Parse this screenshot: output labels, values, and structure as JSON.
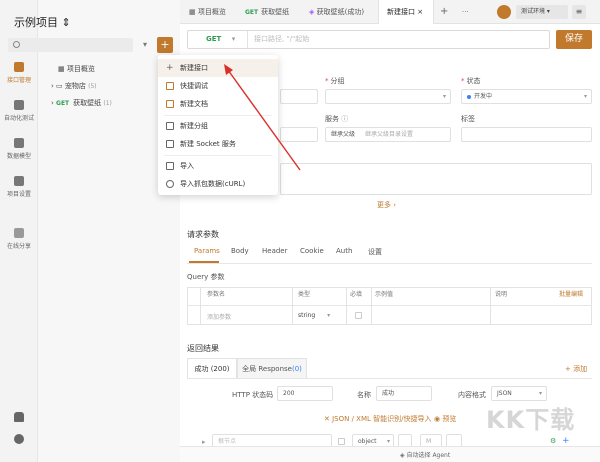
{
  "rail": [
    {
      "label": "接口管理",
      "active": true
    },
    {
      "label": "自动化测试"
    },
    {
      "label": "数据模型"
    },
    {
      "label": "项目设置"
    },
    {
      "label": "在线分享"
    }
  ],
  "tree": {
    "project_title": "示例项目",
    "add_symbol": "+",
    "filter_symbol": "▾",
    "items": [
      {
        "label": "项目概览"
      },
      {
        "label": "宠物店",
        "count": "(5)"
      },
      {
        "method": "GET",
        "label": "获取壁纸",
        "count": "(1)"
      }
    ]
  },
  "tabs": [
    {
      "label": "项目概览"
    },
    {
      "method": "GET",
      "label": "获取壁纸"
    },
    {
      "label": "获取壁纸(成功)"
    },
    {
      "label": "新建接口",
      "active": true
    }
  ],
  "tab_actions": {
    "add": "+",
    "more": "···"
  },
  "env": {
    "label": "测试环境",
    "menu": "≡"
  },
  "url_bar": {
    "method": "GET",
    "placeholder": "接口路径, \"/\"起始",
    "save": "保存"
  },
  "form": {
    "group_label": "分组",
    "status_label": "状态",
    "status_value": "开发中",
    "service_label": "服务",
    "service_value": "继承父级",
    "service_hint": "继承父级目录设置",
    "tags_label": "标签",
    "more": "更多"
  },
  "request": {
    "title": "请求参数",
    "tabs": [
      "Params",
      "Body",
      "Header",
      "Cookie",
      "Auth",
      "设置"
    ],
    "query_title": "Query 参数",
    "columns": [
      "参数名",
      "类型",
      "必填",
      "示例值",
      "说明"
    ],
    "bulk_edit": "批量编辑",
    "row": {
      "name_placeholder": "添加参数",
      "type": "string"
    }
  },
  "response": {
    "title": "返回结果",
    "tabs": [
      {
        "label": "成功 (200)"
      },
      {
        "label": "全局 Response",
        "count": "(0)"
      }
    ],
    "add": "+ 添加",
    "http_code_label": "HTTP 状态码",
    "http_code": "200",
    "name_label": "名称",
    "name": "成功",
    "content_type_label": "内容格式",
    "content_type": "JSON",
    "smart_import": "JSON / XML 智能识别/快捷导入",
    "extra": "预览",
    "root_placeholder": "根节点",
    "root_type": "object"
  },
  "popup": [
    {
      "label": "新建接口"
    },
    {
      "label": "快捷调试"
    },
    {
      "label": "新建文档"
    },
    {
      "label": "新建分组"
    },
    {
      "label": "新建 Socket 服务"
    },
    {
      "label": "导入"
    },
    {
      "label": "导入抓包数据(cURL)"
    }
  ],
  "status_bar": {
    "text": "自动选择 Agent"
  },
  "watermark": "KK下载",
  "colors": {
    "accent": "#c0792d",
    "get": "#2e9d52",
    "arrow": "#d9302c"
  }
}
